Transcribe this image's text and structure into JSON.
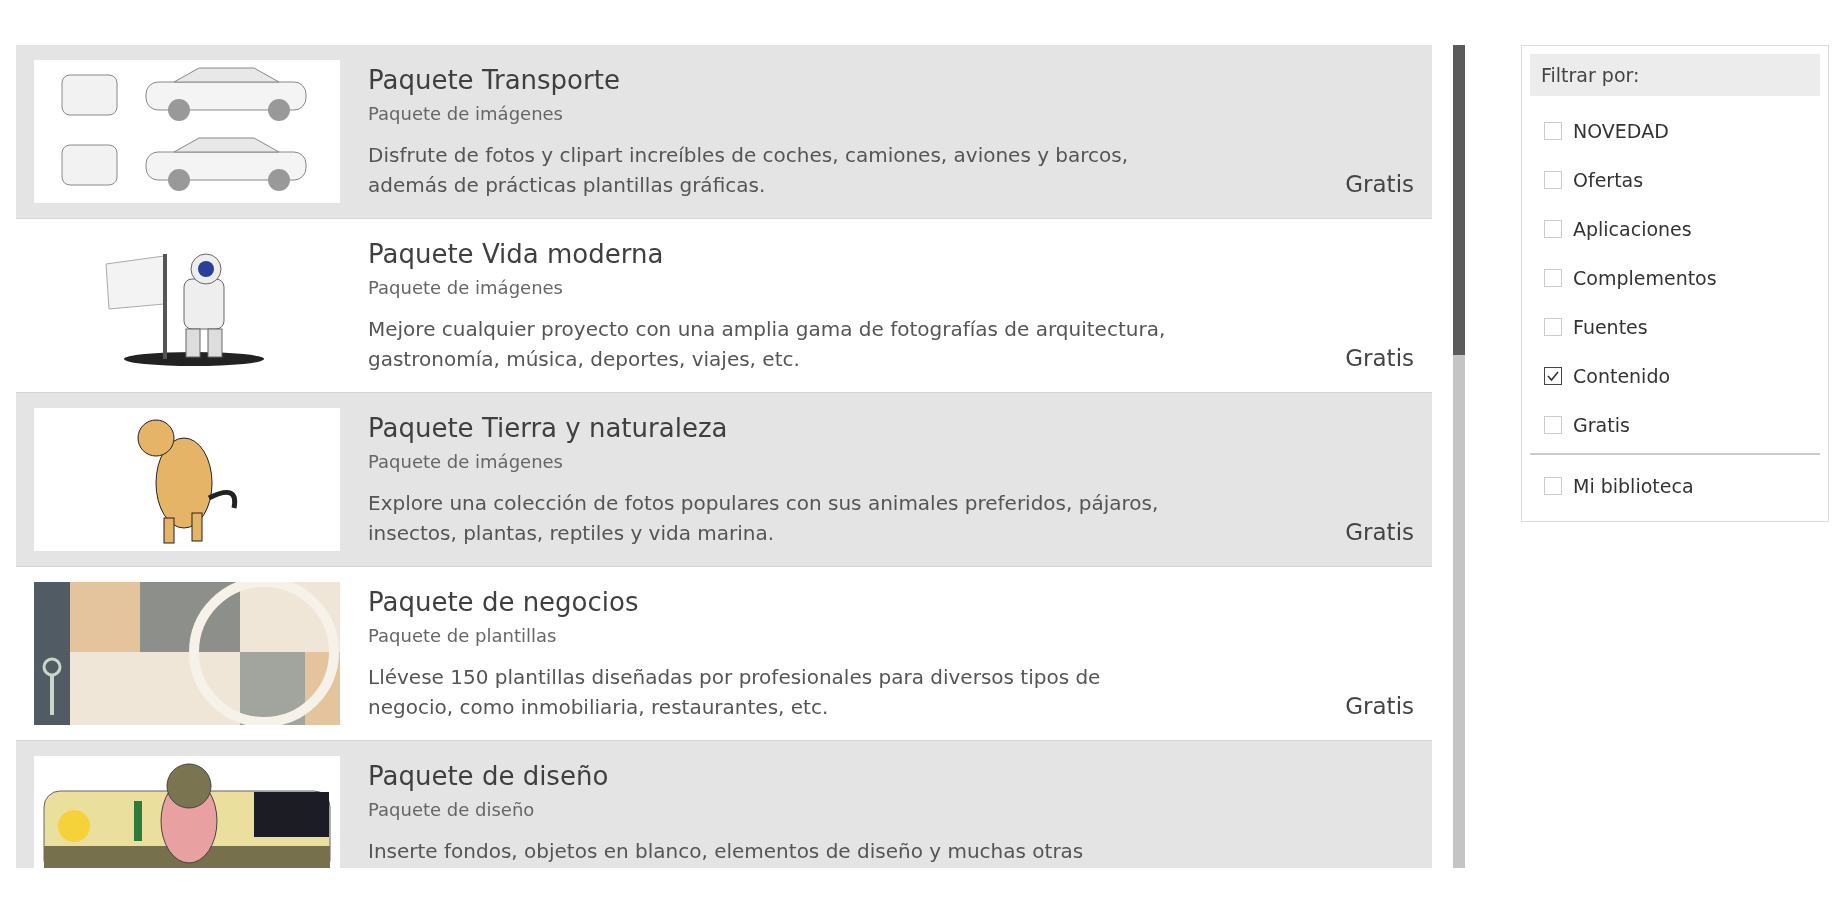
{
  "products": [
    {
      "title": "Paquete Transporte",
      "subtitle": "Paquete de imágenes",
      "description": "Disfrute de fotos y clipart increíbles de coches, camiones, aviones y barcos, además de prácticas plantillas gráficas.",
      "price": "Gratis"
    },
    {
      "title": "Paquete Vida moderna",
      "subtitle": "Paquete de imágenes",
      "description": "Mejore cualquier proyecto con una amplia gama de fotografías de arquitectura, gastronomía, música, deportes, viajes, etc.",
      "price": "Gratis"
    },
    {
      "title": "Paquete Tierra y naturaleza",
      "subtitle": "Paquete de imágenes",
      "description": "Explore una colección de fotos populares con sus animales preferidos, pájaros, insectos, plantas, reptiles y vida marina.",
      "price": "Gratis"
    },
    {
      "title": "Paquete de negocios",
      "subtitle": "Paquete de plantillas",
      "description": "Llévese 150 plantillas diseñadas por profesionales para diversos tipos de negocio, como inmobiliaria, restaurantes, etc.",
      "price": "Gratis"
    },
    {
      "title": "Paquete de diseño",
      "subtitle": "Paquete de diseño",
      "description": "Inserte fondos, objetos en blanco, elementos de diseño y muchas otras"
    }
  ],
  "filter": {
    "title": "Filtrar por:",
    "options": [
      {
        "label": "NOVEDAD",
        "checked": false
      },
      {
        "label": "Ofertas",
        "checked": false
      },
      {
        "label": "Aplicaciones",
        "checked": false
      },
      {
        "label": "Complementos",
        "checked": false
      },
      {
        "label": "Fuentes",
        "checked": false
      },
      {
        "label": "Contenido",
        "checked": true
      },
      {
        "label": "Gratis",
        "checked": false
      }
    ],
    "library": [
      {
        "label": "Mi biblioteca",
        "checked": false
      }
    ]
  }
}
